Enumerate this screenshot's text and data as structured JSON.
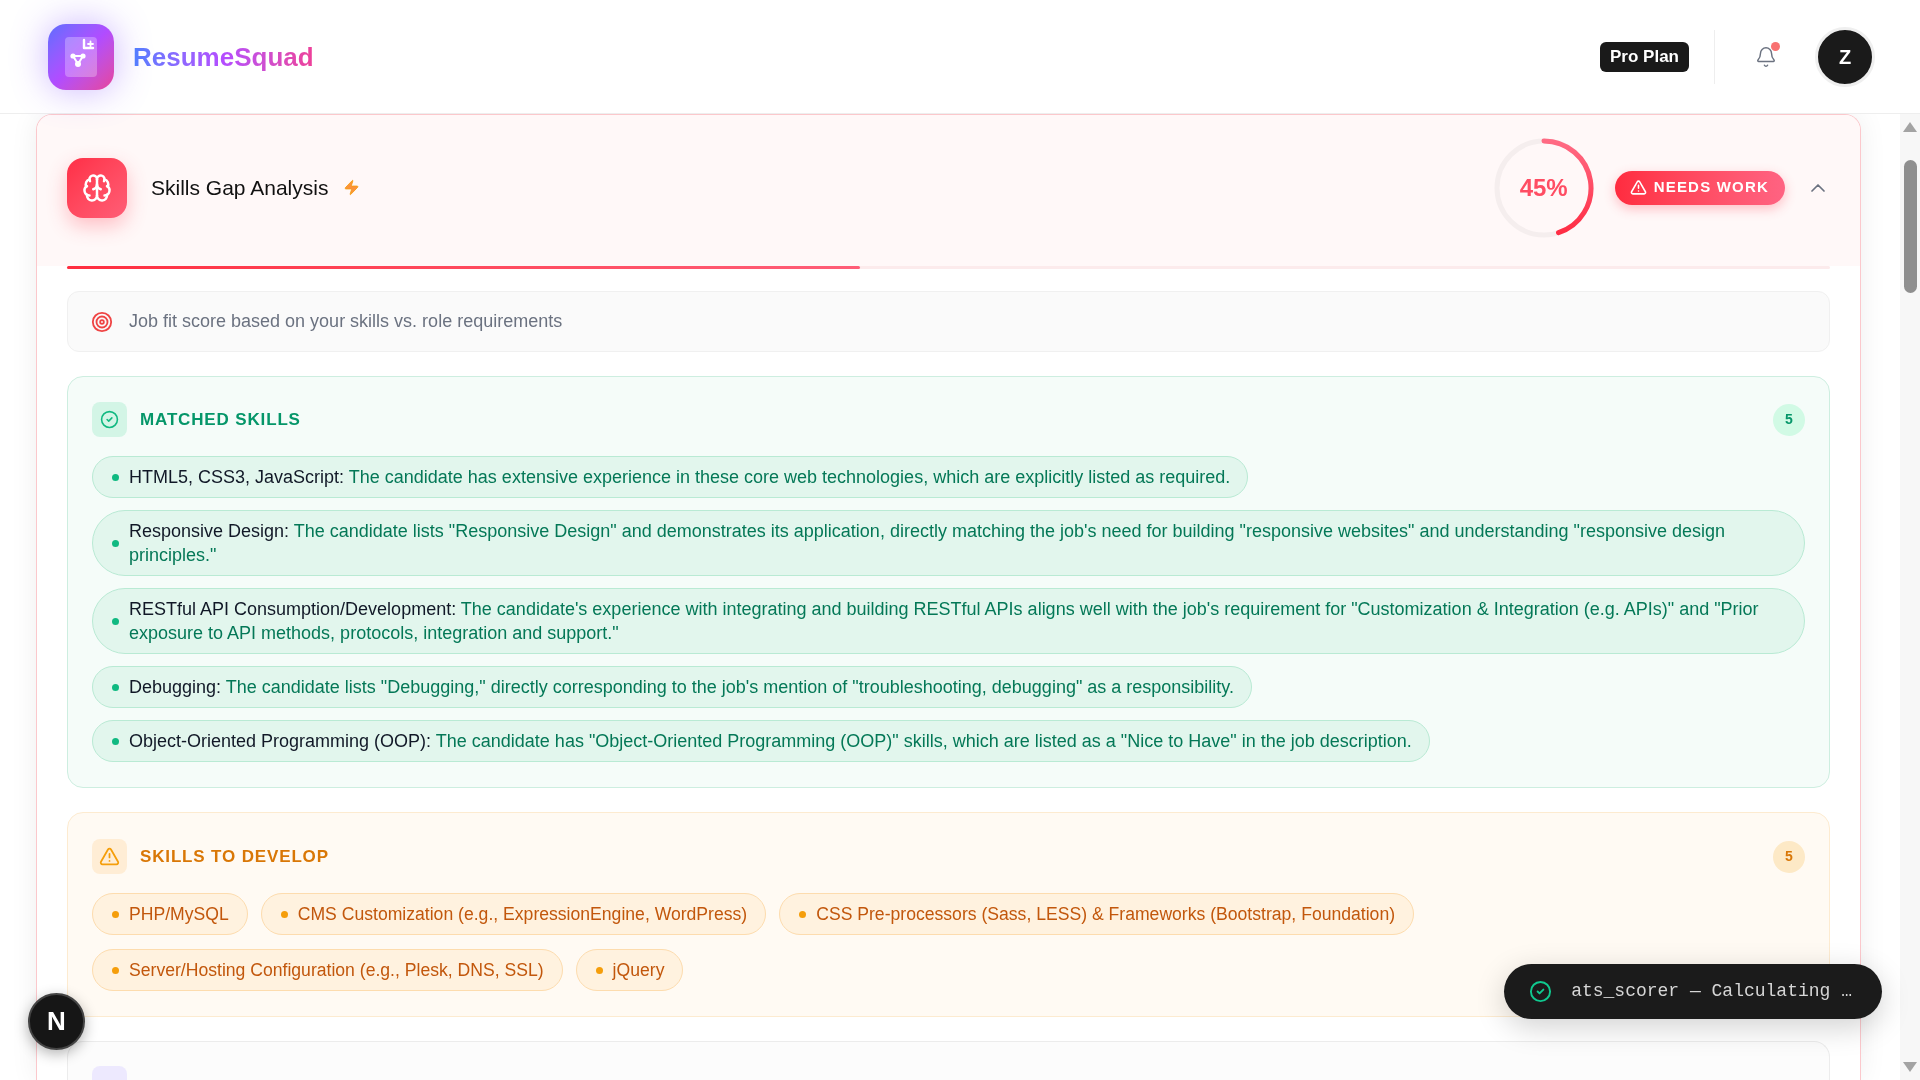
{
  "app": {
    "brand": "ResumeSquad",
    "plan": "Pro Plan",
    "notifications": {
      "unread": true
    },
    "avatar": "Z"
  },
  "analysis": {
    "title": "Skills Gap Analysis",
    "score": {
      "text": "45%",
      "level": 0.45
    },
    "status": {
      "label": "NEEDS WORK",
      "kind": "warning"
    },
    "expanded": true,
    "info": "Job fit score based on your skills vs. role requirements"
  },
  "sections": [
    {
      "kind": "matched",
      "title": "MATCHED SKILLS",
      "count": "5",
      "items": [
        {
          "skill": "HTML5, CSS3, JavaScript:",
          "detail": "The candidate has extensive experience in these core web technologies, which are explicitly listed as required."
        },
        {
          "skill": "Responsive Design:",
          "detail": "The candidate lists \"Responsive Design\" and demonstrates its application, directly matching the job's need for building \"responsive websites\" and understanding \"responsive design principles.\""
        },
        {
          "skill": "RESTful API Consumption/Development:",
          "detail": "The candidate's experience with integrating and building RESTful APIs aligns well with the job's requirement for \"Customization & Integration (e.g. APIs)\" and \"Prior exposure to API methods, protocols, integration and support.\""
        },
        {
          "skill": "Debugging:",
          "detail": "The candidate lists \"Debugging,\" directly corresponding to the job's mention of \"troubleshooting, debugging\" as a responsibility."
        },
        {
          "skill": "Object-Oriented Programming (OOP):",
          "detail": "The candidate has \"Object-Oriented Programming (OOP)\" skills, which are listed as a \"Nice to Have\" in the job description."
        }
      ]
    },
    {
      "kind": "develop",
      "title": "SKILLS TO DEVELOP",
      "count": "5",
      "items": [
        {
          "skill": "PHP/MySQL"
        },
        {
          "skill": "CMS Customization (e.g., ExpressionEngine, WordPress)"
        },
        {
          "skill": "CSS Pre-processors (Sass, LESS) & Frameworks (Bootstrap, Foundation)"
        },
        {
          "skill": "Server/Hosting Configuration (e.g., Plesk, DNS, SSL)"
        },
        {
          "skill": "jQuery"
        }
      ]
    },
    {
      "kind": "other"
    }
  ],
  "toast": {
    "text": "ats_scorer — Calculating …"
  },
  "dev_indicator": {
    "label": "N"
  }
}
